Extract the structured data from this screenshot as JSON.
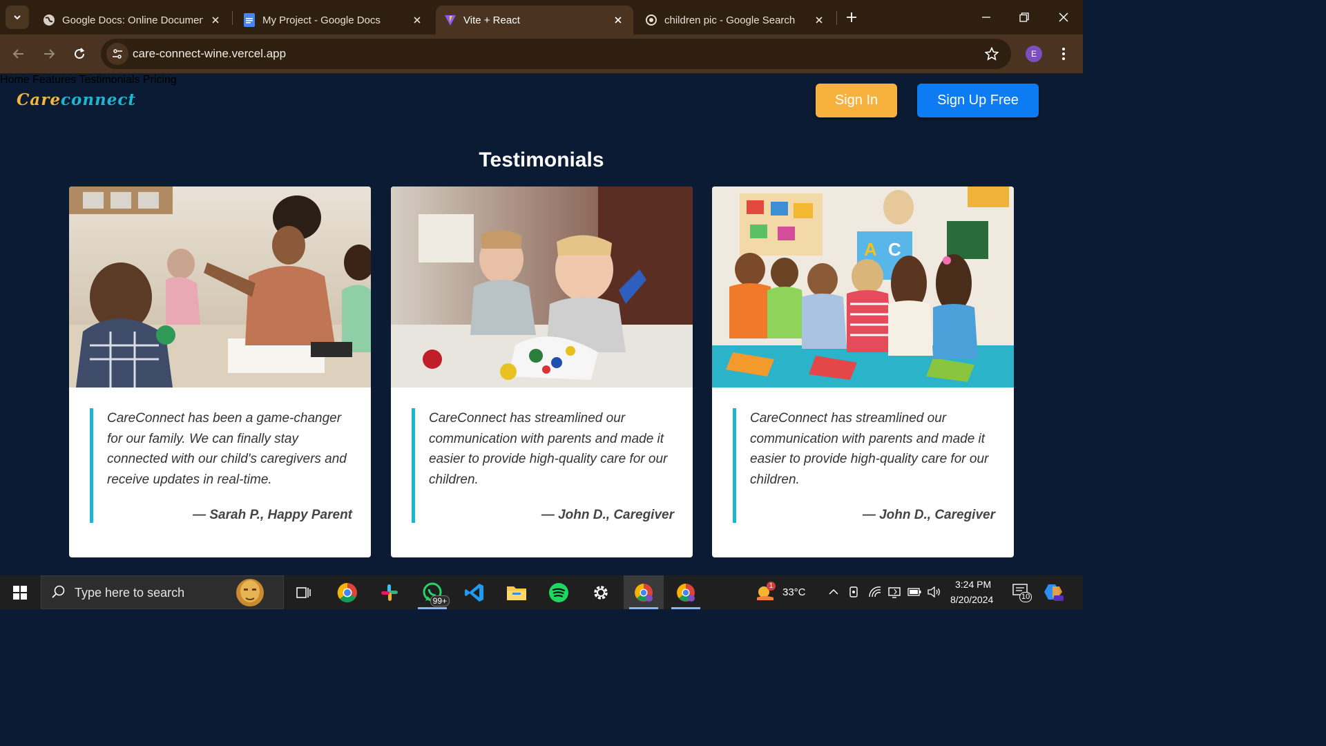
{
  "browser": {
    "tabs": [
      {
        "title": "Google Docs: Online Document",
        "favicon": "globe-icon"
      },
      {
        "title": "My Project - Google Docs",
        "favicon": "google-docs-icon"
      },
      {
        "title": "Vite + React",
        "favicon": "vite-icon",
        "active": true
      },
      {
        "title": "children pic - Google Search",
        "favicon": "google-lens-icon"
      }
    ],
    "url": "care-connect-wine.vercel.app",
    "profile_initial": "E"
  },
  "site": {
    "logo_part1": "Care",
    "logo_part2": "connect",
    "nav": [
      "Home",
      "Features",
      "Testimonials",
      "Pricing"
    ],
    "sign_in": "Sign In",
    "sign_up": "Sign Up Free",
    "section_title": "Testimonials",
    "testimonials": [
      {
        "quote": "CareConnect has been a game-changer for our family. We can finally stay connected with our child's caregivers and receive updates in real-time.",
        "author": "— Sarah P., Happy Parent"
      },
      {
        "quote": "CareConnect has streamlined our communication with parents and made it easier to provide high-quality care for our children.",
        "author": "— John D., Caregiver"
      },
      {
        "quote": "CareConnect has streamlined our communication with parents and made it easier to provide high-quality care for our children.",
        "author": "— John D., Caregiver"
      }
    ]
  },
  "taskbar": {
    "search_placeholder": "Type here to search",
    "whatsapp_badge": "99+",
    "weather_temp": "33°C",
    "weather_badge": "1",
    "time": "3:24 PM",
    "date": "8/20/2024",
    "notifications": "10"
  },
  "colors": {
    "page_bg": "#0b1b33",
    "logo_care": "#f5b53a",
    "logo_connect": "#1cb6cf",
    "sign_in_bg": "#f7b23e",
    "sign_up_bg": "#0d7cf2",
    "quote_border": "#1cb6cf"
  }
}
